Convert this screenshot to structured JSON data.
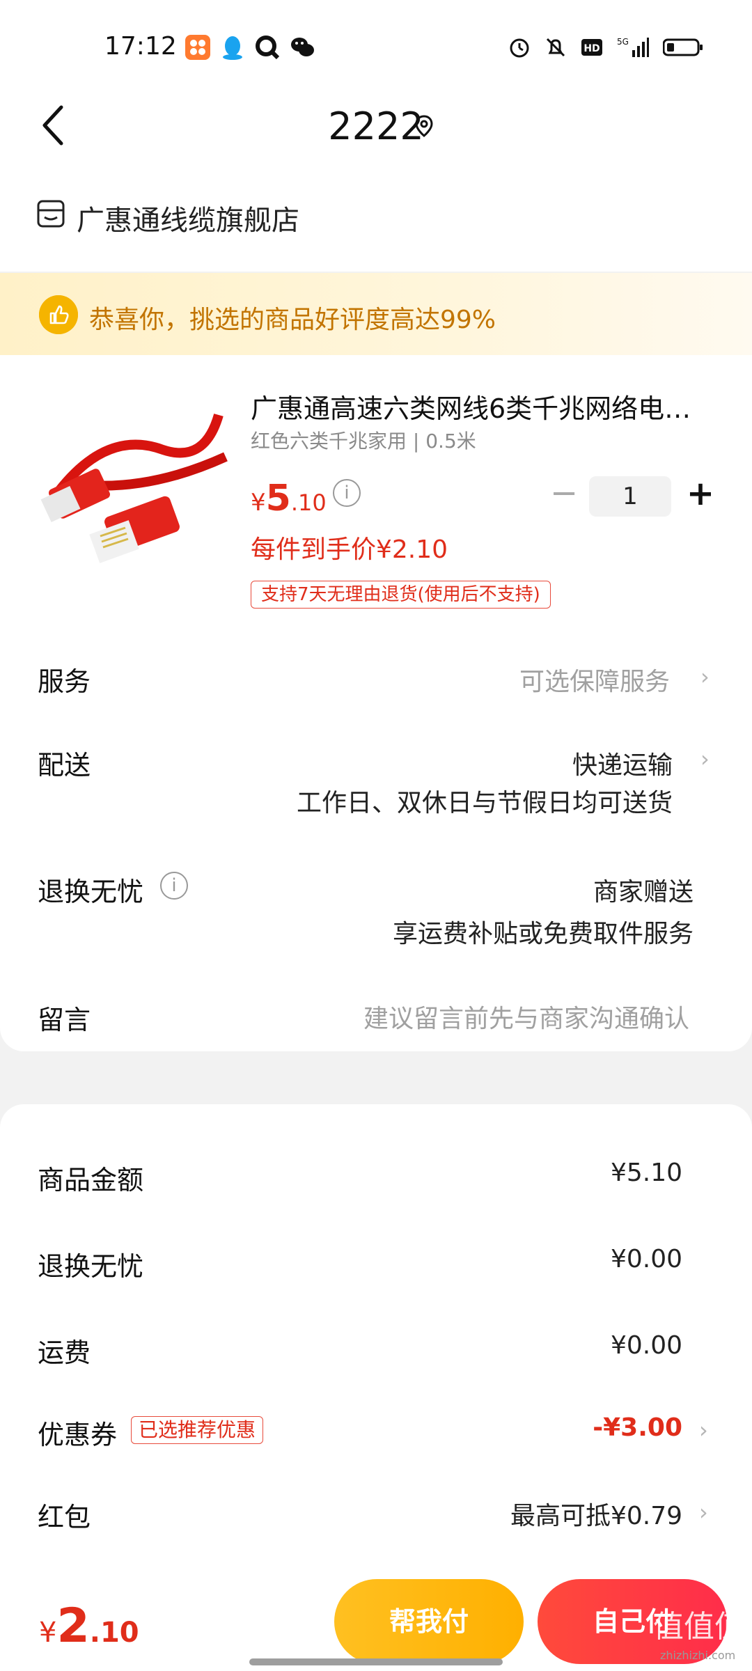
{
  "status": {
    "time": "17:12",
    "network": "5G"
  },
  "nav": {
    "title": "2222"
  },
  "store": {
    "name": "广惠通线缆旗舰店"
  },
  "banner": {
    "text": "恭喜你，挑选的商品好评度高达99%"
  },
  "product": {
    "title": "广惠通高速六类网线6类千兆网络电…",
    "spec": "红色六类千兆家用 | 0.5米",
    "price_symbol": "¥",
    "price_main": "5",
    "price_decimal": ".10",
    "quantity": "1",
    "per_price": "每件到手价¥2.10",
    "return_badge": "支持7天无理由退货(使用后不支持)"
  },
  "rows": {
    "service_label": "服务",
    "service_value": "可选保障服务",
    "delivery_label": "配送",
    "delivery_value": "快递运输",
    "delivery_note": "工作日、双休日与节假日均可送货",
    "return_label": "退换无忧",
    "return_value": "商家赠送",
    "return_note": "享运费补贴或免费取件服务",
    "message_label": "留言",
    "message_placeholder": "建议留言前先与商家沟通确认"
  },
  "summary": {
    "goods_label": "商品金额",
    "goods_value": "¥5.10",
    "return_label": "退换无忧",
    "return_value": "¥0.00",
    "shipping_label": "运费",
    "shipping_value": "¥0.00",
    "coupon_label": "优惠券",
    "coupon_tag": "已选推荐优惠",
    "coupon_value": "-¥3.00",
    "redpacket_label": "红包",
    "redpacket_value": "最高可抵¥0.79"
  },
  "footer": {
    "total_symbol": "¥",
    "total_main": "2",
    "total_decimal": ".10",
    "help_pay": "帮我付",
    "self_pay": "自己付"
  },
  "watermark": {
    "logo": "值值值",
    "site": "zhizhizhi.com"
  },
  "colors": {
    "accent_red": "#e02d1a",
    "button_yellow": "#ffb000",
    "button_red": "#ff3342",
    "banner_text": "#c27400"
  }
}
